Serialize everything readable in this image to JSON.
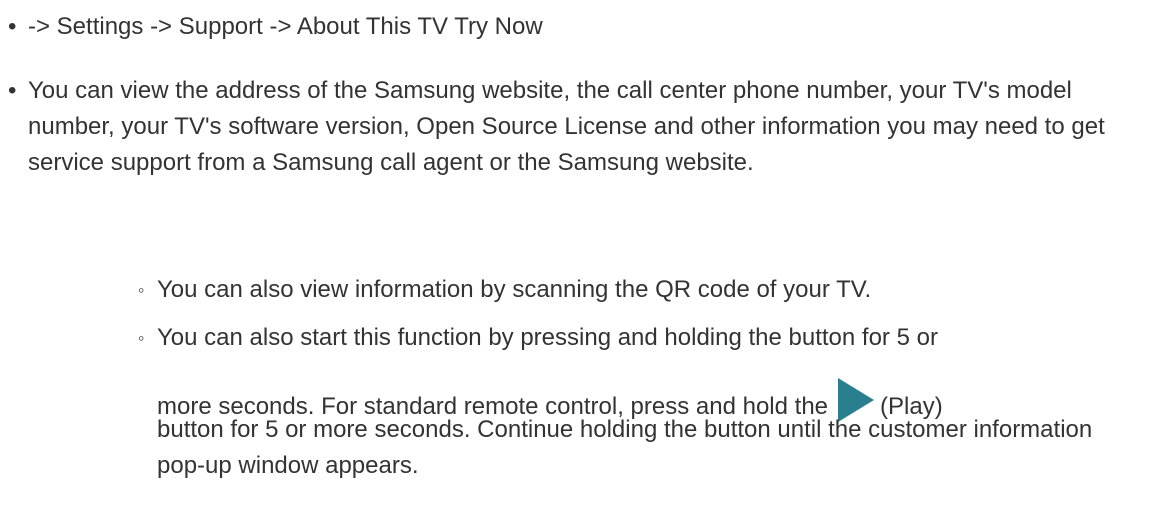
{
  "bullets": {
    "item1": "-> Settings -> Support -> About This TV Try Now",
    "item2": "You can view the address of the Samsung website, the call center phone number, your TV's model number, your TV's software version, Open Source License and other information you may need to get service support from a Samsung call agent or the Samsung website."
  },
  "notes": {
    "note1": "You can also view information by scanning the QR code of your TV.",
    "note2_line1": "You can also start this function by pressing and holding the button for 5 or",
    "note2_line2_before": "more seconds. For standard remote control, press and hold the",
    "note2_line2_after": "(Play)",
    "note2_rest": "button for 5 or more seconds. Continue holding the button until the customer information pop-up window appears."
  },
  "icons": {
    "play": "play-icon",
    "play_color": "#2a7f8f"
  },
  "symbols": {
    "bullet": "•",
    "sub_bullet": "◦"
  }
}
